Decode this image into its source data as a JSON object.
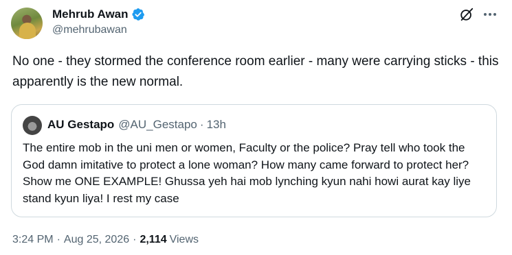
{
  "author": {
    "display_name": "Mehrub Awan",
    "handle": "@mehrubawan",
    "verified": true
  },
  "tweet": {
    "text": "No one - they stormed the conference room earlier - many were carrying sticks - this apparently is the new normal."
  },
  "quoted_tweet": {
    "display_name": "AU Gestapo",
    "handle": "@AU_Gestapo",
    "separator": "·",
    "age": "13h",
    "text": "The entire mob in the uni men or women, Faculty or the police? Pray tell who took the God damn imitative to protect a lone woman? How many came forward to protect her? Show me ONE EXAMPLE! Ghussa yeh hai mob lynching kyun nahi howi aurat kay liye stand kyun liya! I rest my case"
  },
  "meta": {
    "time": "3:24 PM",
    "separator": "·",
    "date": "Aug 25, 2026",
    "views_count": "2,114",
    "views_label": "Views"
  },
  "icons": {
    "verified": "verified-badge-icon",
    "grok": "grok-icon",
    "more": "more-options-icon"
  },
  "colors": {
    "verified": "#1d9bf0",
    "text": "#0f1419",
    "secondary": "#536471",
    "border": "#cfd9de"
  }
}
